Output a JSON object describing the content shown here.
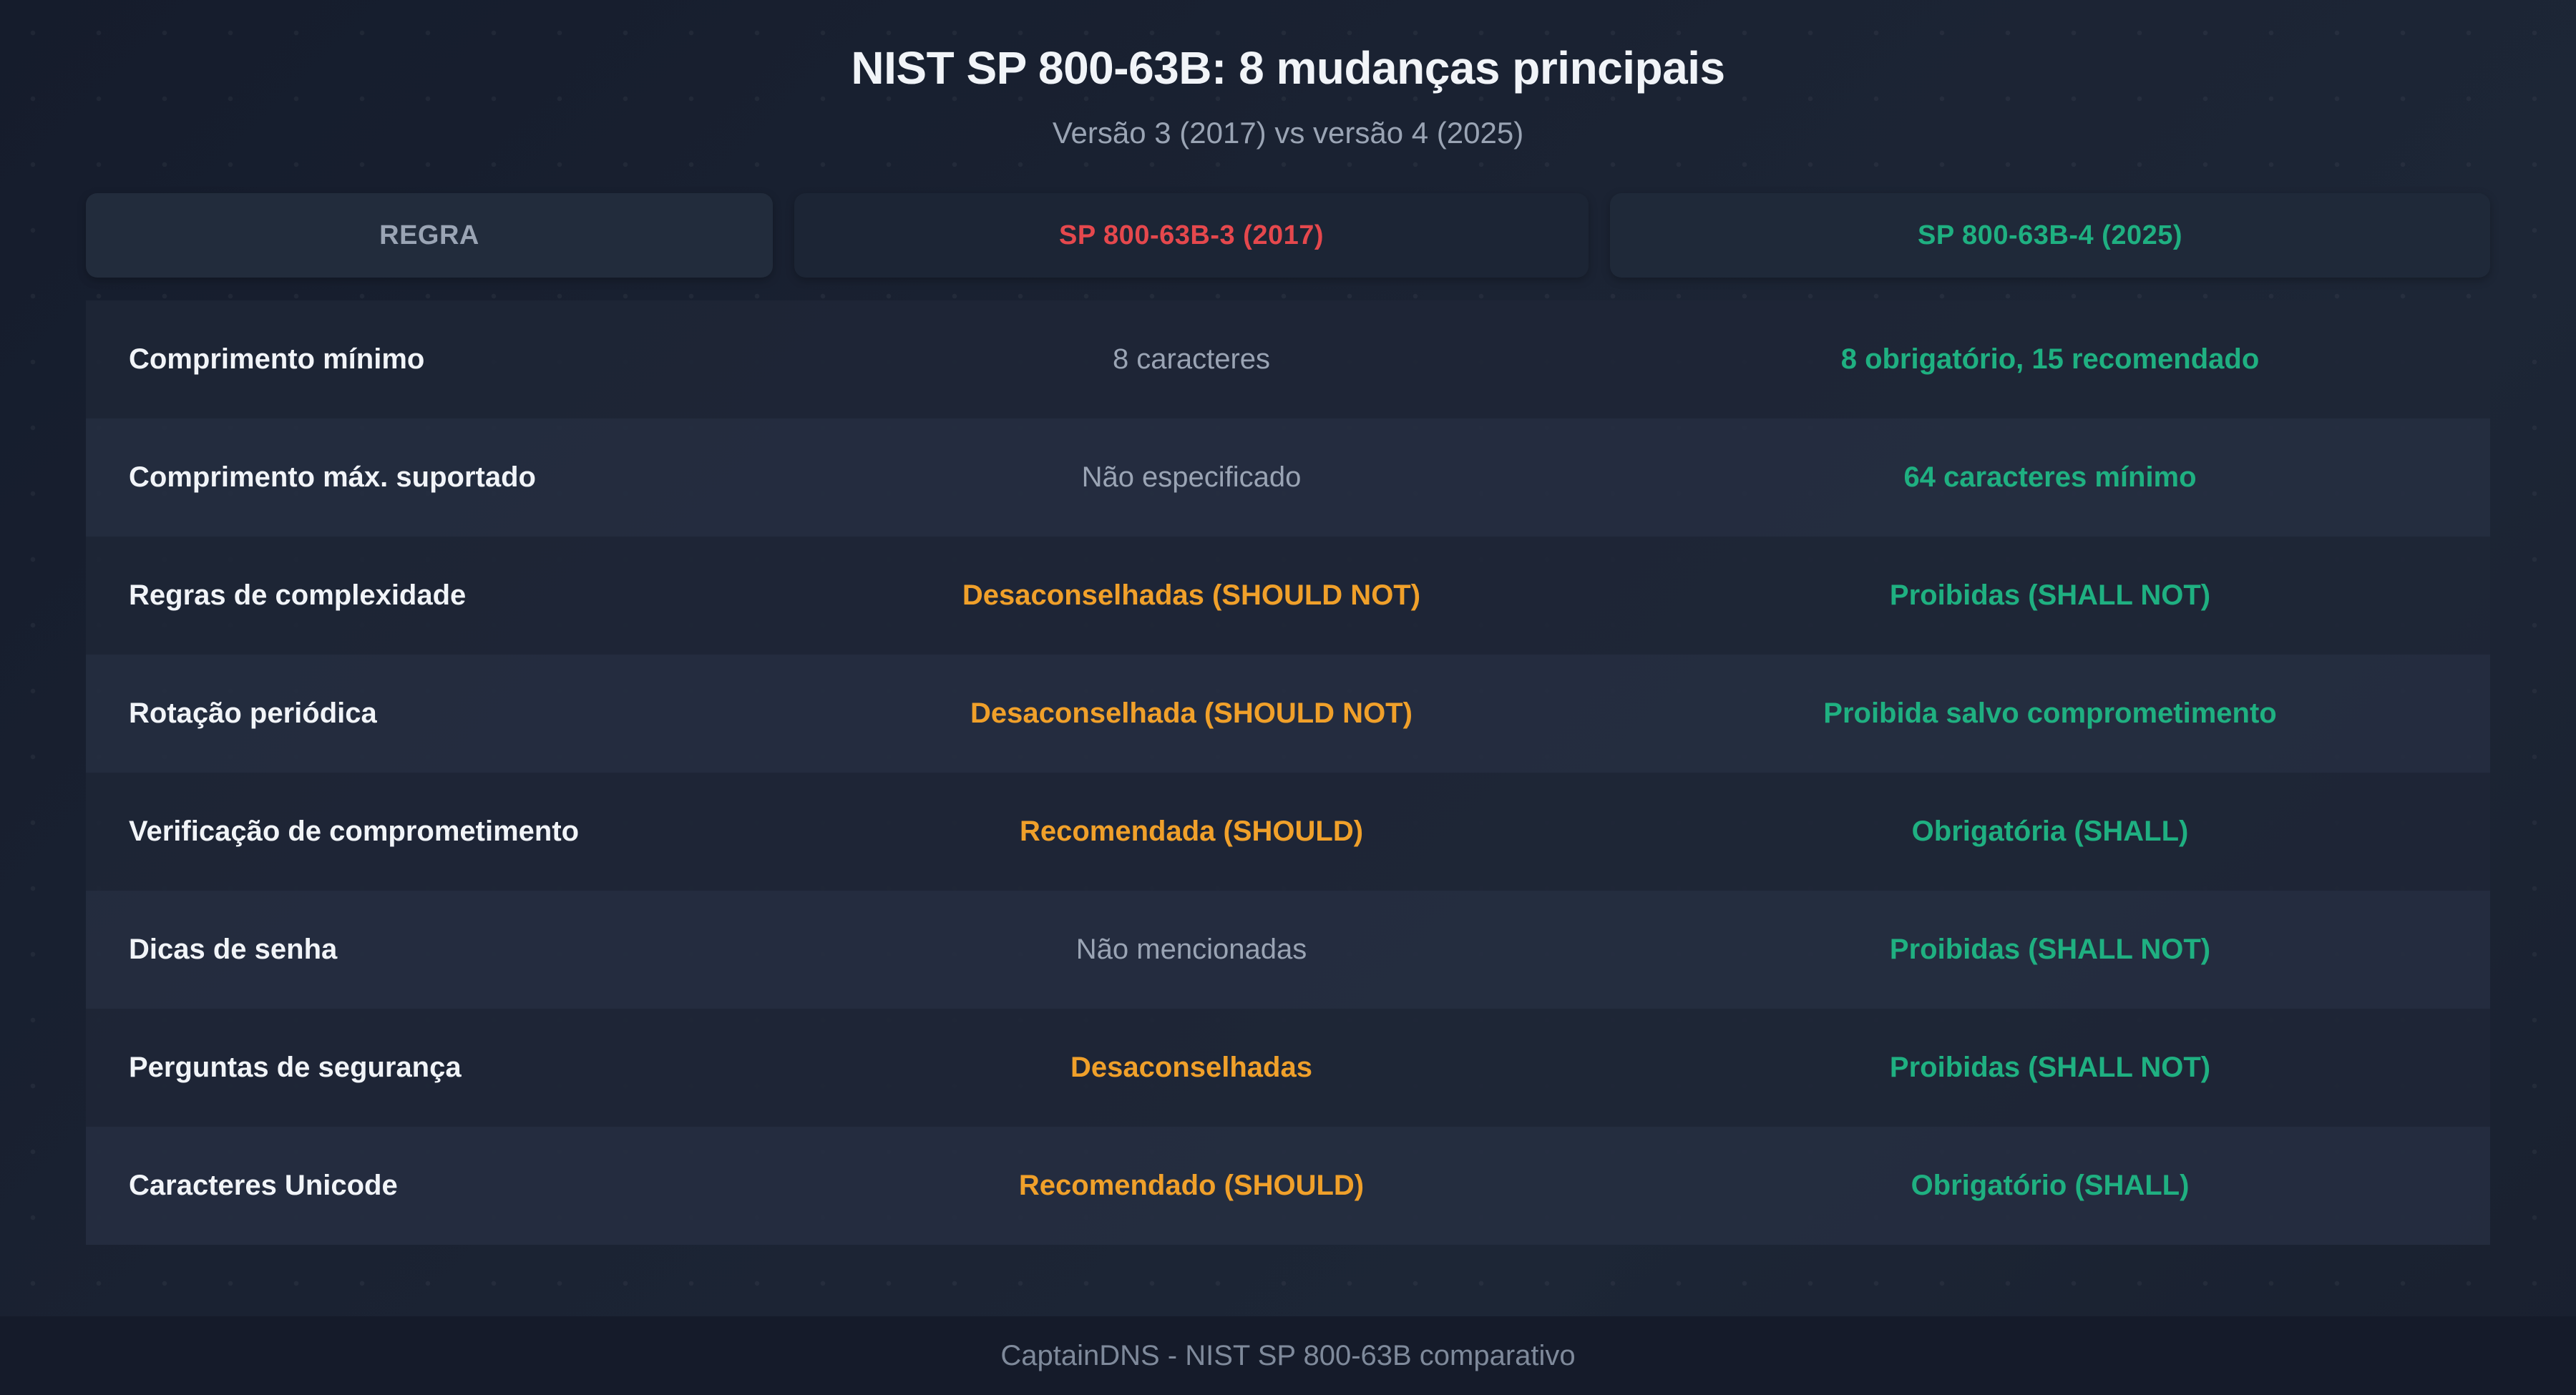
{
  "title": "NIST SP 800-63B: 8 mudanças principais",
  "subtitle": "Versão 3 (2017) vs versão 4 (2025)",
  "colors": {
    "v3_header": "#e5484d",
    "v4_header": "#1fb081",
    "warning": "#f0a02a",
    "success": "#1fb081",
    "neutral": "#9aa4b4"
  },
  "headers": {
    "rule": "REGRA",
    "v3": "SP 800-63B-3 (2017)",
    "v4": "SP 800-63B-4 (2025)"
  },
  "rows": [
    {
      "rule": "Comprimento mínimo",
      "v3": "8 caracteres",
      "v3_tone": "gray",
      "v4": "8 obrigatório, 15 recomendado"
    },
    {
      "rule": "Comprimento máx. suportado",
      "v3": "Não especificado",
      "v3_tone": "gray",
      "v4": "64 caracteres mínimo"
    },
    {
      "rule": "Regras de complexidade",
      "v3": "Desaconselhadas (SHOULD NOT)",
      "v3_tone": "orange",
      "v4": "Proibidas (SHALL NOT)"
    },
    {
      "rule": "Rotação periódica",
      "v3": "Desaconselhada (SHOULD NOT)",
      "v3_tone": "orange",
      "v4": "Proibida salvo comprometimento"
    },
    {
      "rule": "Verificação de comprometimento",
      "v3": "Recomendada (SHOULD)",
      "v3_tone": "orange",
      "v4": "Obrigatória (SHALL)"
    },
    {
      "rule": "Dicas de senha",
      "v3": "Não mencionadas",
      "v3_tone": "gray",
      "v4": "Proibidas (SHALL NOT)"
    },
    {
      "rule": "Perguntas de segurança",
      "v3": "Desaconselhadas",
      "v3_tone": "orange",
      "v4": "Proibidas (SHALL NOT)"
    },
    {
      "rule": "Caracteres Unicode",
      "v3": "Recomendado (SHOULD)",
      "v3_tone": "orange",
      "v4": "Obrigatório (SHALL)"
    }
  ],
  "footer": "CaptainDNS - NIST SP 800-63B comparativo"
}
